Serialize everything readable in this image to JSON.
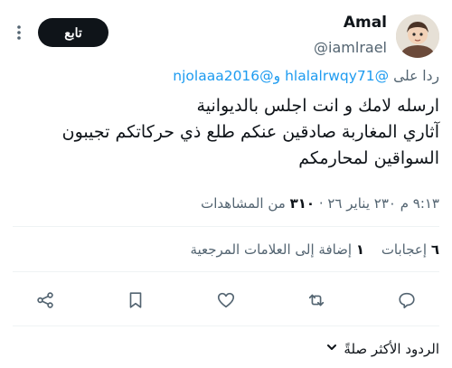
{
  "author": {
    "name": "Amal",
    "handle": "@iamlrael"
  },
  "follow_button": {
    "label": "تابع"
  },
  "reply_to": {
    "prefix": "ردا على",
    "mention_1": "@hlalalrwqy71",
    "joiner": "و",
    "mention_2": "@njolaaa2016"
  },
  "tweet": {
    "lines": [
      "ارسله لامك و انت اجلس بالديوانية",
      "آثاري المغاربة صادقين عنكم طلع ذي حركاتكم تجيبون",
      "السواقين لمحارمكم"
    ]
  },
  "meta": {
    "time_date": "٩:١٣ م ٢٣٠ يناير ٢٦ ·",
    "views_count": "٣١٠",
    "views_label": "من المشاهدات"
  },
  "stats": {
    "likes_count": "٦",
    "likes_label": "إعجابات",
    "bookmarks_count": "١",
    "bookmarks_label": "إضافة إلى العلامات المرجعية"
  },
  "actions": {
    "icons": [
      "share-icon",
      "bookmark-icon",
      "like-icon",
      "retweet-icon",
      "reply-icon"
    ]
  },
  "replies_sort": {
    "label": "الردود الأكثر صلةً"
  },
  "colors": {
    "text": "#0f1419",
    "muted": "#536471",
    "link": "#1d9bf0",
    "divider": "#eff3f4",
    "follow_bg": "#0f1419"
  }
}
